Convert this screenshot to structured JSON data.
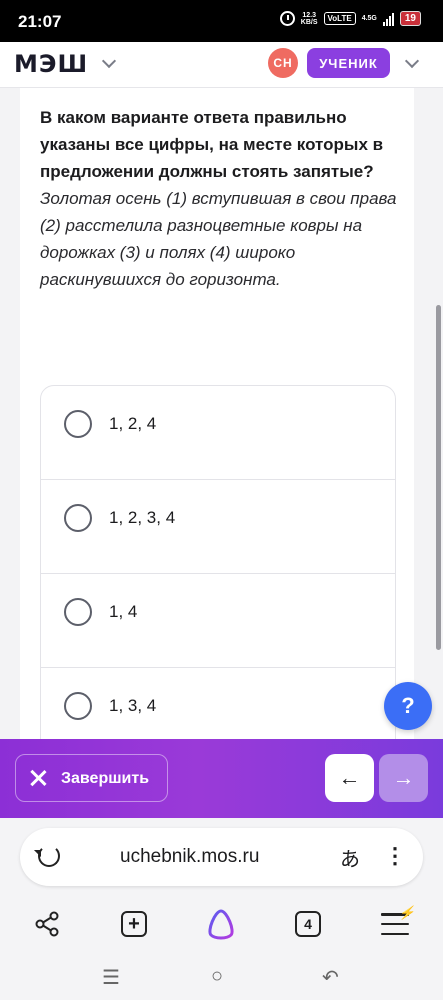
{
  "status_bar": {
    "time": "21:07",
    "speed_value": "12.3",
    "speed_unit": "KB/S",
    "volte": "VoLTE",
    "network": "4.5G",
    "battery": "19"
  },
  "header": {
    "logo": "МЭШ",
    "avatar_initials": "СН",
    "role_label": "УЧЕНИК"
  },
  "question": {
    "prompt": "В каком варианте ответа правильно указаны все цифры, на месте которых в предложении должны стоять запятые?",
    "sentence": "Золотая осень (1) вступившая в свои права (2) расстелила разноцветные ковры на дорожках (3) и полях (4) широко раскинувшихся до горизонта."
  },
  "options": [
    {
      "label": "1, 2, 4"
    },
    {
      "label": "1, 2, 3, 4"
    },
    {
      "label": "1, 4"
    },
    {
      "label": "1, 3, 4"
    }
  ],
  "help_button": {
    "label": "?"
  },
  "action_bar": {
    "finish_label": "Завершить",
    "prev_arrow": "←",
    "next_arrow": "→"
  },
  "browser": {
    "url": "uchebnik.mos.ru",
    "translate_glyph": "あ",
    "menu_glyph": "⋮",
    "tabs_count": "4",
    "add_glyph": "+"
  },
  "system_nav": {
    "recents": "☰",
    "home": "○",
    "back": "↶"
  },
  "colors": {
    "brand_purple": "#8b3fe0",
    "avatar_red": "#ef6b61",
    "help_blue": "#3b6ef6"
  }
}
